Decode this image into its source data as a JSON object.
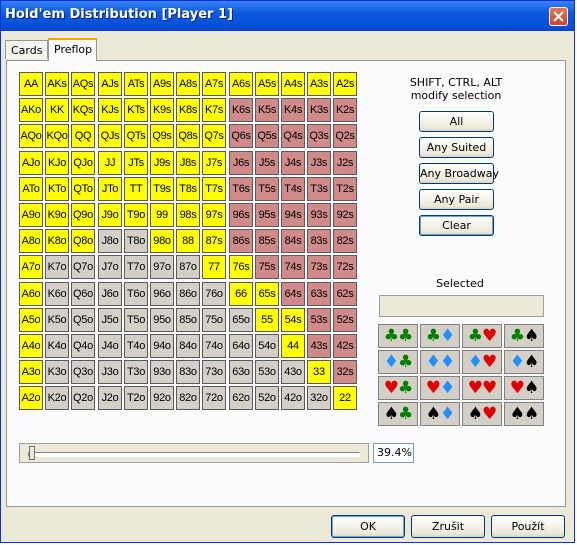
{
  "window": {
    "title": "Hold'em Distribution [Player 1]"
  },
  "tabs": [
    {
      "label": "Cards"
    },
    {
      "label": "Preflop"
    }
  ],
  "grid": {
    "rows": [
      [
        "AA",
        "AKs",
        "AQs",
        "AJs",
        "ATs",
        "A9s",
        "A8s",
        "A7s",
        "A6s",
        "A5s",
        "A4s",
        "A3s",
        "A2s"
      ],
      [
        "AKo",
        "KK",
        "KQs",
        "KJs",
        "KTs",
        "K9s",
        "K8s",
        "K7s",
        "K6s",
        "K5s",
        "K4s",
        "K3s",
        "K2s"
      ],
      [
        "AQo",
        "KQo",
        "QQ",
        "QJs",
        "QTs",
        "Q9s",
        "Q8s",
        "Q7s",
        "Q6s",
        "Q5s",
        "Q4s",
        "Q3s",
        "Q2s"
      ],
      [
        "AJo",
        "KJo",
        "QJo",
        "JJ",
        "JTs",
        "J9s",
        "J8s",
        "J7s",
        "J6s",
        "J5s",
        "J4s",
        "J3s",
        "J2s"
      ],
      [
        "ATo",
        "KTo",
        "QTo",
        "JTo",
        "TT",
        "T9s",
        "T8s",
        "T7s",
        "T6s",
        "T5s",
        "T4s",
        "T3s",
        "T2s"
      ],
      [
        "A9o",
        "K9o",
        "Q9o",
        "J9o",
        "T9o",
        "99",
        "98s",
        "97s",
        "96s",
        "95s",
        "94s",
        "93s",
        "92s"
      ],
      [
        "A8o",
        "K8o",
        "Q8o",
        "J8o",
        "T8o",
        "98o",
        "88",
        "87s",
        "86s",
        "85s",
        "84s",
        "83s",
        "82s"
      ],
      [
        "A7o",
        "K7o",
        "Q7o",
        "J7o",
        "T7o",
        "97o",
        "87o",
        "77",
        "76s",
        "75s",
        "74s",
        "73s",
        "72s"
      ],
      [
        "A6o",
        "K6o",
        "Q6o",
        "J6o",
        "T6o",
        "96o",
        "86o",
        "76o",
        "66",
        "65s",
        "64s",
        "63s",
        "62s"
      ],
      [
        "A5o",
        "K5o",
        "Q5o",
        "J5o",
        "T5o",
        "95o",
        "85o",
        "75o",
        "65o",
        "55",
        "54s",
        "53s",
        "52s"
      ],
      [
        "A4o",
        "K4o",
        "Q4o",
        "J4o",
        "T4o",
        "94o",
        "84o",
        "74o",
        "64o",
        "54o",
        "44",
        "43s",
        "42s"
      ],
      [
        "A3o",
        "K3o",
        "Q3o",
        "J3o",
        "T3o",
        "93o",
        "83o",
        "73o",
        "63o",
        "53o",
        "43o",
        "33",
        "32s"
      ],
      [
        "A2o",
        "K2o",
        "Q2o",
        "J2o",
        "T2o",
        "92o",
        "82o",
        "72o",
        "62o",
        "52o",
        "42o",
        "32o",
        "22"
      ]
    ],
    "states": [
      "yyyyyyyyyyyyy",
      "yyyyyyyyrrrrr",
      "yyyyyyyyrrrrr",
      "yyyyyyyyrrrrr",
      "yyyyyyyyrrrrr",
      "yyyyyyyyrrrrr",
      "yyyggyyyrrrrr",
      "yggggggyyrrrr",
      "ygggggggyyrrr",
      "yggggggggyyrr",
      "ygggggggggyrr",
      "yggggggggggyr",
      "ygggggggggggy"
    ],
    "colors": {
      "selected": "#ffff00",
      "suited": "#d08a8a",
      "offsuit": "#d4d0c8"
    }
  },
  "side": {
    "note_line1": "SHIFT, CTRL, ALT",
    "note_line2": "modify selection",
    "buttons": [
      "All",
      "Any Suited",
      "Any Broadway",
      "Any Pair",
      "Clear"
    ],
    "selected_label": "Selected",
    "selected_value": ""
  },
  "suit_buttons": [
    [
      [
        "club",
        "club"
      ],
      [
        "club",
        "diamond"
      ],
      [
        "club",
        "heart"
      ],
      [
        "club",
        "spade"
      ]
    ],
    [
      [
        "diamond",
        "club"
      ],
      [
        "diamond",
        "diamond"
      ],
      [
        "diamond",
        "heart"
      ],
      [
        "diamond",
        "spade"
      ]
    ],
    [
      [
        "heart",
        "club"
      ],
      [
        "heart",
        "diamond"
      ],
      [
        "heart",
        "heart"
      ],
      [
        "heart",
        "spade"
      ]
    ],
    [
      [
        "spade",
        "club"
      ],
      [
        "spade",
        "diamond"
      ],
      [
        "spade",
        "heart"
      ],
      [
        "spade",
        "spade"
      ]
    ]
  ],
  "slider": {
    "percent_label": "39.4%",
    "level": 0.0
  },
  "footer": {
    "ok": "OK",
    "reset": "Zrušit",
    "apply": "Použít"
  }
}
